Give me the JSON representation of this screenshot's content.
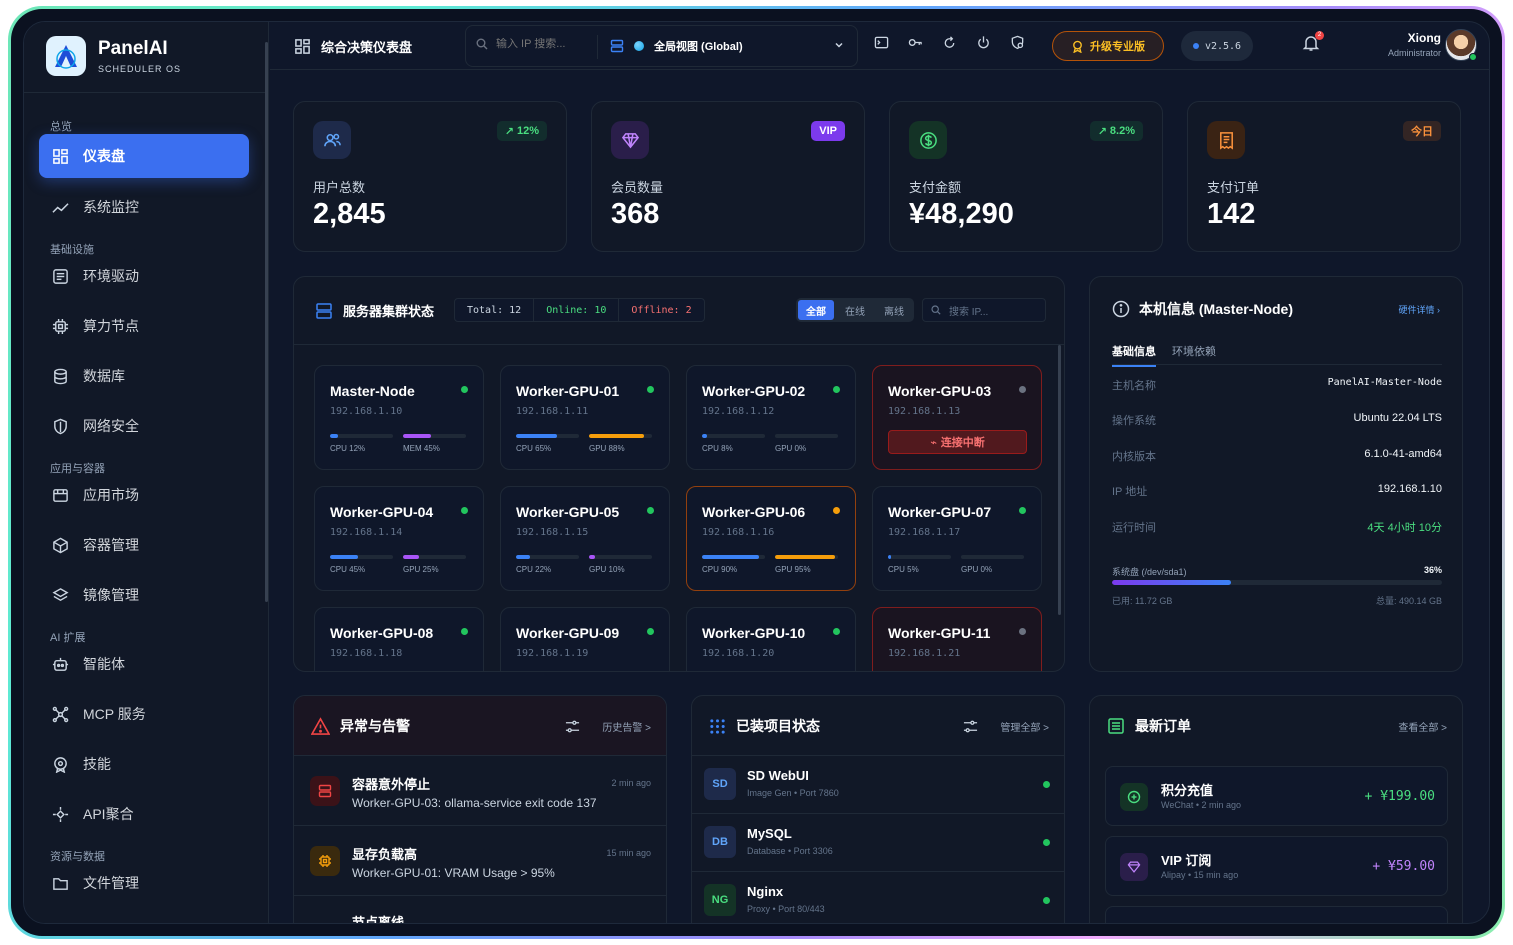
{
  "brand": {
    "name": "PanelAI",
    "subtitle": "SCHEDULER OS"
  },
  "sidebar": {
    "sections": [
      "总览",
      "基础设施",
      "应用与容器",
      "AI 扩展",
      "资源与数据"
    ],
    "items": [
      {
        "label": "仪表盘",
        "icon": "dashboard-icon"
      },
      {
        "label": "系统监控",
        "icon": "chart-line-icon"
      },
      {
        "label": "环境驱动",
        "icon": "terminal-box-icon"
      },
      {
        "label": "算力节点",
        "icon": "cpu-icon"
      },
      {
        "label": "数据库",
        "icon": "database-icon"
      },
      {
        "label": "网络安全",
        "icon": "shield-icon"
      },
      {
        "label": "应用市场",
        "icon": "store-icon"
      },
      {
        "label": "容器管理",
        "icon": "cube-icon"
      },
      {
        "label": "镜像管理",
        "icon": "layers-icon"
      },
      {
        "label": "智能体",
        "icon": "robot-icon"
      },
      {
        "label": "MCP 服务",
        "icon": "network-nodes-icon"
      },
      {
        "label": "技能",
        "icon": "skill-icon"
      },
      {
        "label": "API聚合",
        "icon": "api-hub-icon"
      },
      {
        "label": "文件管理",
        "icon": "folder-icon"
      }
    ]
  },
  "header": {
    "title": "综合决策仪表盘",
    "search_placeholder": "输入 IP 搜索...",
    "scope": "全局视图 (Global)",
    "upgrade": "升级专业版",
    "version": "v2.5.6",
    "notifications": "2",
    "user_name": "Xiong",
    "user_role": "Administrator"
  },
  "stats": [
    {
      "label": "用户总数",
      "value": "2,845",
      "badge": "12%",
      "color": "#22c55e"
    },
    {
      "label": "会员数量",
      "value": "368",
      "badge": "VIP",
      "color": "#a855f7"
    },
    {
      "label": "支付金额",
      "value": "¥48,290",
      "badge": "8.2%",
      "color": "#22c55e"
    },
    {
      "label": "支付订单",
      "value": "142",
      "badge": "今日",
      "color": "#f97316"
    }
  ],
  "cluster": {
    "title": "服务器集群状态",
    "total": "Total: 12",
    "online": "Online: 10",
    "offline": "Offline: 2",
    "tabs": [
      "全部",
      "在线",
      "离线"
    ],
    "search_placeholder": "搜索 IP...",
    "disconnected_label": "连接中断",
    "nodes": [
      {
        "name": "Master-Node",
        "ip": "192.168.1.10",
        "status": "online",
        "m1": "CPU 12%",
        "m1v": 0.12,
        "m2": "MEM 45%",
        "m2v": 0.45,
        "m2c": "#a855f7"
      },
      {
        "name": "Worker-GPU-01",
        "ip": "192.168.1.11",
        "status": "online",
        "m1": "CPU 65%",
        "m1v": 0.65,
        "m2": "GPU 88%",
        "m2v": 0.88,
        "m2c": "#f59e0b"
      },
      {
        "name": "Worker-GPU-02",
        "ip": "192.168.1.12",
        "status": "online",
        "m1": "CPU 8%",
        "m1v": 0.08,
        "m2": "GPU 0%",
        "m2v": 0.0,
        "m2c": "#a855f7"
      },
      {
        "name": "Worker-GPU-03",
        "ip": "192.168.1.13",
        "status": "offline"
      },
      {
        "name": "Worker-GPU-04",
        "ip": "192.168.1.14",
        "status": "online",
        "m1": "CPU 45%",
        "m1v": 0.45,
        "m2": "GPU 25%",
        "m2v": 0.25,
        "m2c": "#a855f7"
      },
      {
        "name": "Worker-GPU-05",
        "ip": "192.168.1.15",
        "status": "online",
        "m1": "CPU 22%",
        "m1v": 0.22,
        "m2": "GPU 10%",
        "m2v": 0.1,
        "m2c": "#a855f7"
      },
      {
        "name": "Worker-GPU-06",
        "ip": "192.168.1.16",
        "status": "warning",
        "m1": "CPU 90%",
        "m1v": 0.9,
        "m2": "GPU 95%",
        "m2v": 0.95,
        "m2c": "#f59e0b"
      },
      {
        "name": "Worker-GPU-07",
        "ip": "192.168.1.17",
        "status": "online",
        "m1": "CPU 5%",
        "m1v": 0.05,
        "m2": "GPU 0%",
        "m2v": 0.0,
        "m2c": "#a855f7"
      },
      {
        "name": "Worker-GPU-08",
        "ip": "192.168.1.18",
        "status": "online"
      },
      {
        "name": "Worker-GPU-09",
        "ip": "192.168.1.19",
        "status": "online"
      },
      {
        "name": "Worker-GPU-10",
        "ip": "192.168.1.20",
        "status": "online"
      },
      {
        "name": "Worker-GPU-11",
        "ip": "192.168.1.21",
        "status": "offline"
      }
    ]
  },
  "host": {
    "title": "本机信息 (Master-Node)",
    "link": "硬件详情 ›",
    "tabs": [
      "基础信息",
      "环境依赖"
    ],
    "rows": [
      {
        "k": "主机名称",
        "v": "PanelAI-Master-Node"
      },
      {
        "k": "操作系统",
        "v": "Ubuntu 22.04 LTS"
      },
      {
        "k": "内核版本",
        "v": "6.1.0-41-amd64"
      },
      {
        "k": "IP 地址",
        "v": "192.168.1.10"
      },
      {
        "k": "运行时间",
        "v": "4天 4小时 10分"
      }
    ],
    "disk_label": "系统盘 (/dev/sda1)",
    "disk_pct": "36%",
    "disk_used": "已用: 11.72 GB",
    "disk_total": "总量: 490.14 GB",
    "disk_fraction": 0.36
  },
  "alerts": {
    "title": "异常与告警",
    "action": "历史告警 >",
    "items": [
      {
        "title": "容器意外停止",
        "desc": "Worker-GPU-03: ollama-service exit code 137",
        "time": "2 min ago"
      },
      {
        "title": "显存负载高",
        "desc": "Worker-GPU-01: VRAM Usage > 95%",
        "time": "15 min ago"
      },
      {
        "title": "节点离线"
      }
    ]
  },
  "projects": {
    "title": "已装项目状态",
    "action": "管理全部 >",
    "items": [
      {
        "badge": "SD",
        "name": "SD WebUI",
        "meta": "Image Gen • Port 7860"
      },
      {
        "badge": "DB",
        "name": "MySQL",
        "meta": "Database • Port 3306"
      },
      {
        "badge": "NG",
        "name": "Nginx",
        "meta": "Proxy • Port 80/443"
      }
    ]
  },
  "orders": {
    "title": "最新订单",
    "action": "查看全部 >",
    "items": [
      {
        "name": "积分充值",
        "meta": "WeChat • 2 min ago",
        "amount": "+ ¥199.00"
      },
      {
        "name": "VIP 订阅",
        "meta": "Alipay • 15 min ago",
        "amount": "+ ¥59.00"
      }
    ]
  },
  "colors": {
    "accent": "#3b6ff0",
    "online": "#22c55e",
    "offline": "#6b7280",
    "warning": "#f59e0b",
    "danger": "#ef4444"
  }
}
